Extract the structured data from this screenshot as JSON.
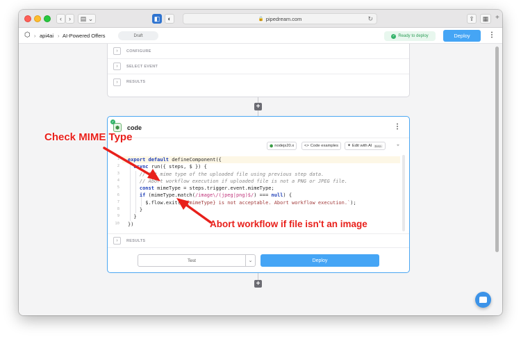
{
  "browser": {
    "url": "pipedream.com",
    "back_icon": "chevron-left-icon",
    "forward_icon": "chevron-right-icon"
  },
  "header": {
    "breadcrumb": [
      "api4ai",
      "AI-Powered Offers"
    ],
    "draft_label": "Draft",
    "status_label": "Ready to deploy",
    "deploy_label": "Deploy"
  },
  "config_card": {
    "rows": [
      "CONFIGURE",
      "SELECT EVENT",
      "RESULTS"
    ]
  },
  "code_card": {
    "title": "code",
    "runtime_label": "nodejs20.x",
    "examples_label": "Code examples",
    "ai_label": "Edit with AI",
    "beta_label": "Beta",
    "results_label": "RESULTS",
    "test_label": "Test",
    "deploy_label": "Deploy",
    "line_numbers": [
      "1",
      "2",
      "3",
      "4",
      "5",
      "6",
      "7",
      "8",
      "9",
      "10"
    ]
  },
  "annotations": {
    "mime": "Check MIME Type",
    "abort": "Abort workflow if file isn't an image"
  },
  "colors": {
    "accent": "#45a5f5",
    "ready_green": "#34b36a",
    "annotation_red": "#e8201b"
  }
}
